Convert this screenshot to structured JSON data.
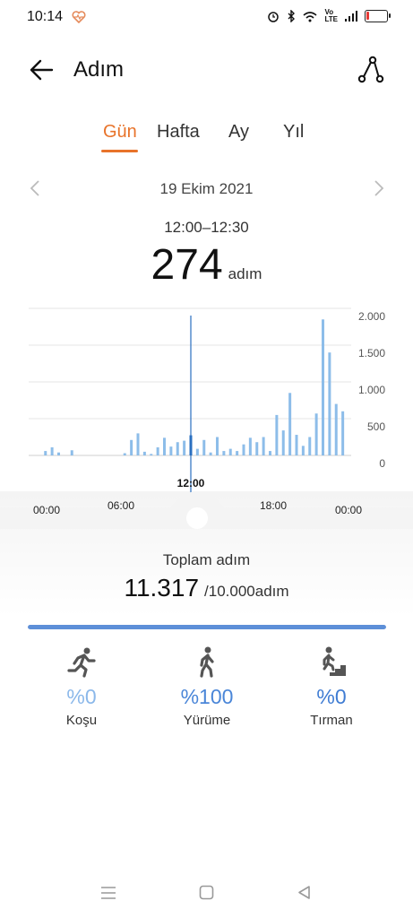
{
  "status": {
    "time": "10:14",
    "network": "Vo\nLTE"
  },
  "header": {
    "title": "Adım"
  },
  "tabs": [
    "Gün",
    "Hafta",
    "Ay",
    "Yıl"
  ],
  "date_label": "19 Ekim 2021",
  "selected": {
    "time_range": "12:00–12:30",
    "steps": "274",
    "unit": "adım",
    "marker_label": "12:00"
  },
  "chart_data": {
    "type": "bar",
    "x_labels_bottom": [
      "00:00",
      "00:00"
    ],
    "x_labels_top": [
      "06:00",
      "18:00"
    ],
    "y_ticks": [
      "2.000",
      "1.500",
      "1.000",
      "500",
      "0"
    ],
    "ylim": [
      0,
      2000
    ],
    "xlim_hours": [
      0,
      24
    ],
    "bars": [
      {
        "h": 1.0,
        "v": 60
      },
      {
        "h": 1.5,
        "v": 110
      },
      {
        "h": 2.0,
        "v": 40
      },
      {
        "h": 3.0,
        "v": 70
      },
      {
        "h": 7.0,
        "v": 30
      },
      {
        "h": 7.5,
        "v": 210
      },
      {
        "h": 8.0,
        "v": 300
      },
      {
        "h": 8.5,
        "v": 50
      },
      {
        "h": 9.0,
        "v": 20
      },
      {
        "h": 9.5,
        "v": 110
      },
      {
        "h": 10.0,
        "v": 240
      },
      {
        "h": 10.5,
        "v": 120
      },
      {
        "h": 11.0,
        "v": 180
      },
      {
        "h": 11.5,
        "v": 200
      },
      {
        "h": 12.0,
        "v": 274,
        "selected": true
      },
      {
        "h": 12.5,
        "v": 90
      },
      {
        "h": 13.0,
        "v": 210
      },
      {
        "h": 13.5,
        "v": 40
      },
      {
        "h": 14.0,
        "v": 250
      },
      {
        "h": 14.5,
        "v": 60
      },
      {
        "h": 15.0,
        "v": 90
      },
      {
        "h": 15.5,
        "v": 60
      },
      {
        "h": 16.0,
        "v": 150
      },
      {
        "h": 16.5,
        "v": 240
      },
      {
        "h": 17.0,
        "v": 180
      },
      {
        "h": 17.5,
        "v": 250
      },
      {
        "h": 18.0,
        "v": 60
      },
      {
        "h": 18.5,
        "v": 550
      },
      {
        "h": 19.0,
        "v": 340
      },
      {
        "h": 19.5,
        "v": 850
      },
      {
        "h": 20.0,
        "v": 280
      },
      {
        "h": 20.5,
        "v": 130
      },
      {
        "h": 21.0,
        "v": 250
      },
      {
        "h": 21.5,
        "v": 570
      },
      {
        "h": 22.0,
        "v": 1850
      },
      {
        "h": 22.5,
        "v": 1400
      },
      {
        "h": 23.0,
        "v": 700
      },
      {
        "h": 23.5,
        "v": 600
      }
    ]
  },
  "summary": {
    "label": "Toplam adım",
    "total": "11.317",
    "goal": "/10.000adım",
    "progress": 1.0
  },
  "activities": [
    {
      "icon": "running-icon",
      "percent": "%0",
      "label": "Koşu",
      "color": "#8bb8ea"
    },
    {
      "icon": "walking-icon",
      "percent": "%100",
      "label": "Yürüme",
      "color": "#4a86d8"
    },
    {
      "icon": "climbing-icon",
      "percent": "%0",
      "label": "Tırman",
      "color": "#3f7cd3"
    }
  ],
  "colors": {
    "accent": "#e8732a",
    "bar": "#8dbde9",
    "bar_selected": "#2a6fc0"
  }
}
